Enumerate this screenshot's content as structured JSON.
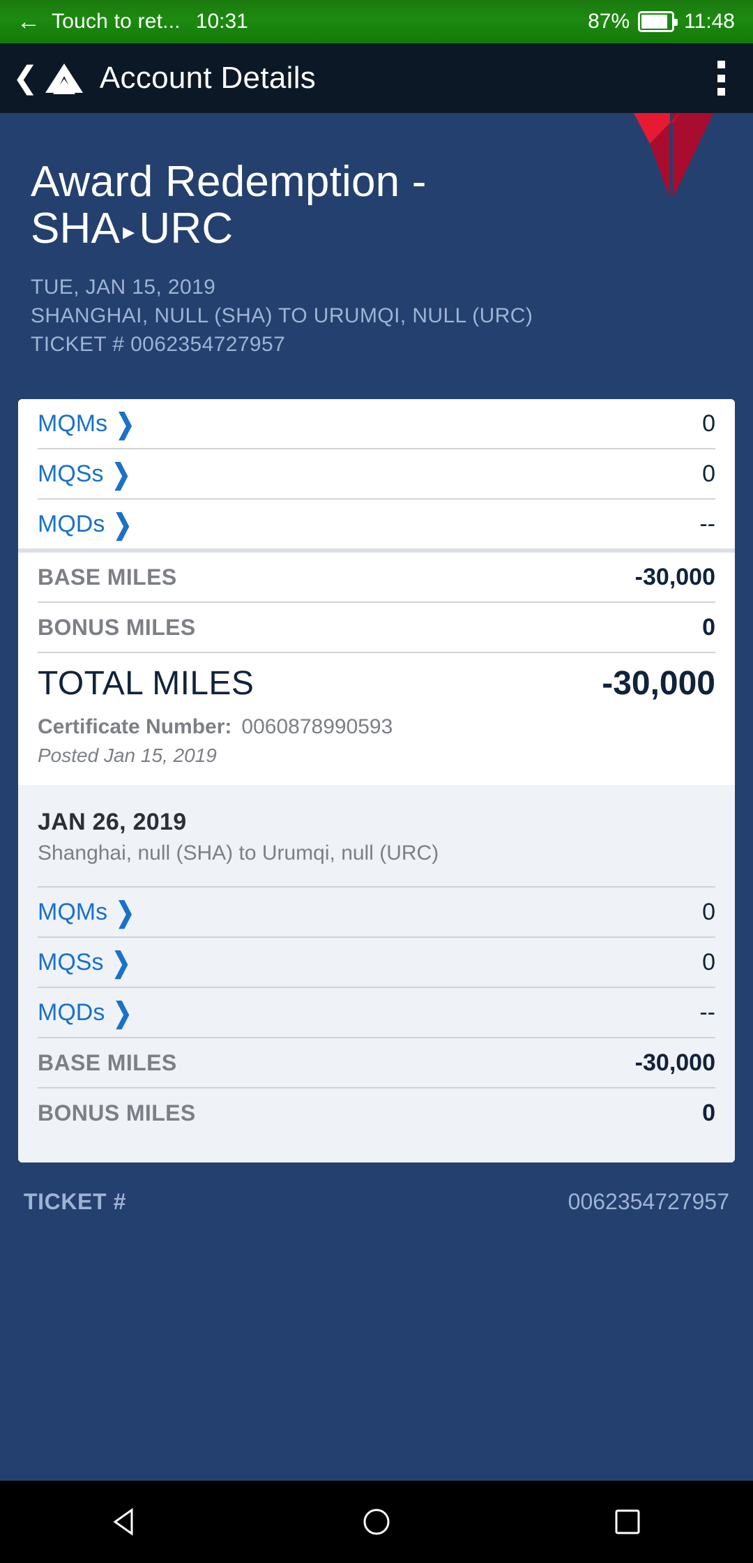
{
  "status_bar": {
    "back_icon": "arrow-left-icon",
    "return_text": "Touch to ret...",
    "left_time": "10:31",
    "battery_pct": "87%",
    "battery_icon": "battery-icon",
    "right_time": "11:48",
    "bg_color": "#1d8a10"
  },
  "app_bar": {
    "back_icon": "chevron-left-icon",
    "logo_icon": "delta-widget-white-icon",
    "title": "Account Details",
    "overflow_icon": "overflow-menu-icon",
    "bg_color": "#0d1827"
  },
  "hero": {
    "logo_icon": "delta-widget-red-icon",
    "title_line1": "Award Redemption -",
    "origin_code": "SHA",
    "arrow": "▸",
    "dest_code": "URC",
    "date": "TUE, JAN 15, 2019",
    "route": "SHANGHAI, NULL (SHA) TO URUMQI, NULL (URC)",
    "ticket": "TICKET # 0062354727957",
    "bg_color": "#24406e",
    "sub_color": "#9db4d6"
  },
  "card": {
    "qualifying_rows": [
      {
        "label": "MQMs",
        "value": "0"
      },
      {
        "label": "MQSs",
        "value": "0"
      },
      {
        "label": "MQDs",
        "value": "--"
      }
    ],
    "miles_rows": [
      {
        "label": "BASE MILES",
        "value": "-30,000"
      },
      {
        "label": "BONUS MILES",
        "value": "0"
      }
    ],
    "total_label": "TOTAL MILES",
    "total_value": "-30,000",
    "certificate_label": "Certificate Number:",
    "certificate_number": "0060878990593",
    "posted": "Posted Jan 15, 2019",
    "link_color": "#1a71c8"
  },
  "segment": {
    "date": "JAN 26, 2019",
    "route": "Shanghai, null (SHA) to Urumqi, null (URC)",
    "qualifying_rows": [
      {
        "label": "MQMs",
        "value": "0"
      },
      {
        "label": "MQSs",
        "value": "0"
      },
      {
        "label": "MQDs",
        "value": "--"
      }
    ],
    "miles_rows": [
      {
        "label": "BASE MILES",
        "value": "-30,000"
      },
      {
        "label": "BONUS MILES",
        "value": "0"
      }
    ],
    "bg_color": "#eff2f7"
  },
  "footer": {
    "ticket_label": "TICKET #",
    "ticket_value": "0062354727957"
  },
  "nav_bar": {
    "back_icon": "triangle-back-icon",
    "home_icon": "circle-home-icon",
    "recents_icon": "square-recents-icon"
  }
}
